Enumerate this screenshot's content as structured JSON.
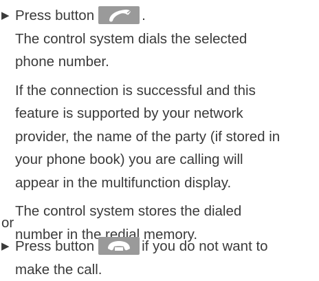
{
  "step1": {
    "prefix": "Press button",
    "suffix": ".",
    "icon": "call-accept-icon",
    "result": "The control system dials the selected phone number.",
    "result_lines": [
      "The control system dials the selected",
      "phone number."
    ],
    "detail": "If the connection is successful and this feature is supported by your network provider, the name of the party (if stored in your phone book) you are calling will appear in the multifunction display.",
    "detail_lines": [
      "If the connection is successful and this",
      "feature is supported by your network",
      "provider, the name of the party (if stored in",
      "your phone book) you are calling will",
      "appear in the multifunction display."
    ],
    "storage": "The control system stores the dialed number in the redial memory.",
    "storage_lines": [
      "The control system stores the dialed",
      "number in the redial memory."
    ]
  },
  "or_label": "or",
  "step2": {
    "prefix": "Press button",
    "icon": "call-end-icon",
    "suffix": "if you do not want to",
    "suffix_line2": "make the call."
  }
}
